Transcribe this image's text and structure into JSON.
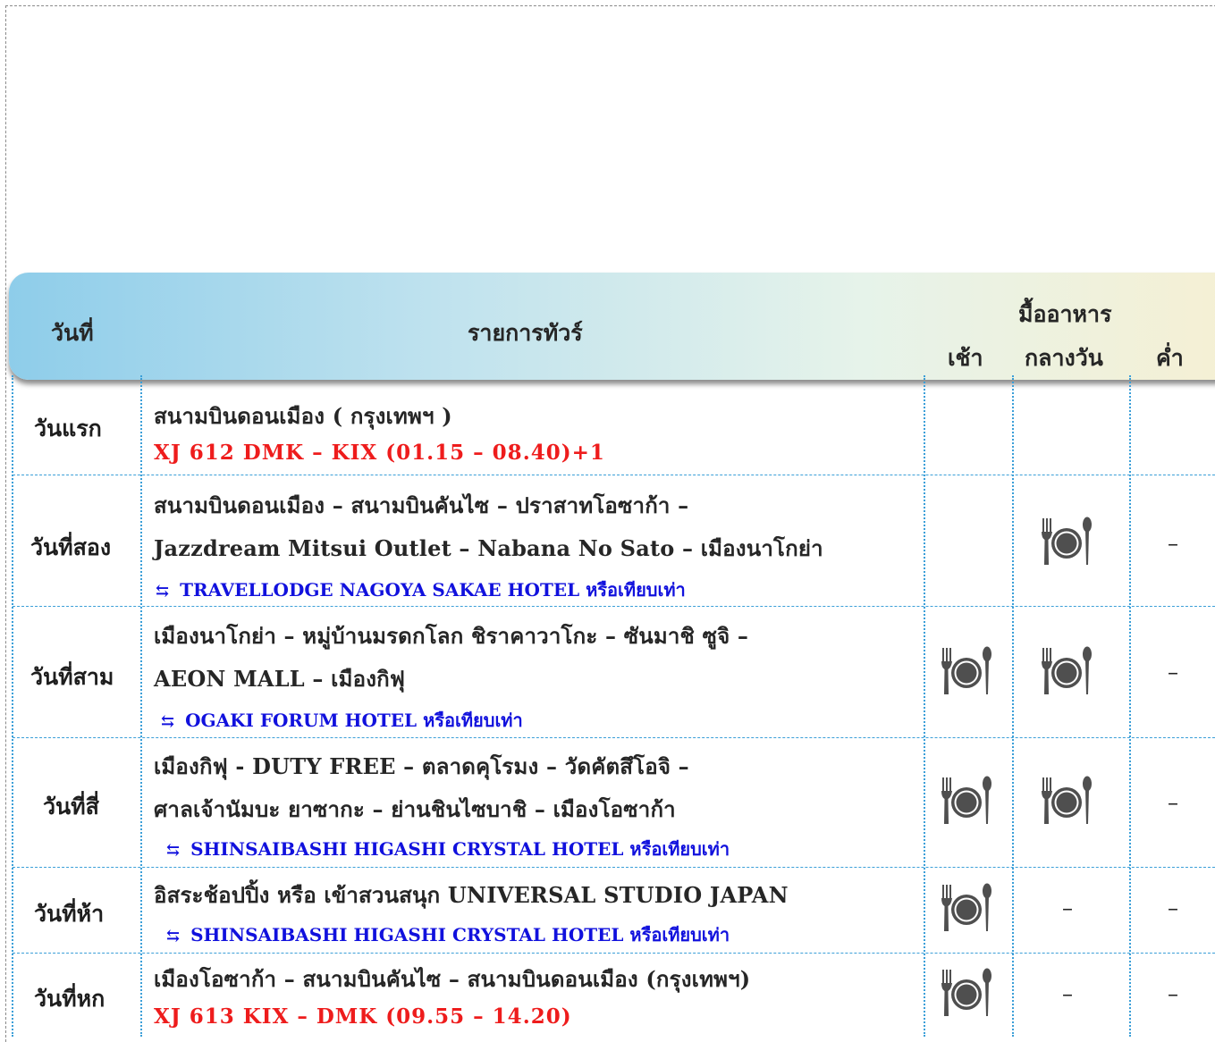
{
  "header": {
    "day_col": "วันที่",
    "program_col": "รายการทัวร์",
    "meals_group": "มื้ออาหาร",
    "breakfast": "เช้า",
    "lunch": "กลางวัน",
    "dinner": "ค่ำ"
  },
  "icons": {
    "meal": "plate-fork-knife-icon",
    "hotel": "bed-icon"
  },
  "colors": {
    "flight_text": "#ee1c1c",
    "hotel_text": "#1111dd",
    "grid_line": "#3b9fd8",
    "icon": "#4f4f4f"
  },
  "rows": [
    {
      "day": "วันแรก",
      "lines": [
        "สนามบินดอนเมือง ( กรุงเทพฯ )"
      ],
      "flight": "XJ 612  DMK – KIX  (01.15 – 08.40)+1",
      "hotel": "",
      "meals": {
        "breakfast": "",
        "lunch": "",
        "dinner": ""
      }
    },
    {
      "day": "วันที่สอง",
      "lines": [
        "สนามบินดอนเมือง – สนามบินคันไซ – ปราสาทโอซาก้า –",
        "Jazzdream Mitsui Outlet – Nabana No Sato – เมืองนาโกย่า"
      ],
      "flight": "",
      "hotel": "TRAVELLODGE NAGOYA SAKAE HOTEL หรือเทียบเท่า",
      "meals": {
        "breakfast": "",
        "lunch": "icon",
        "dinner": "–"
      }
    },
    {
      "day": "วันที่สาม",
      "lines": [
        "เมืองนาโกย่า – หมู่บ้านมรดกโลก ชิราคาวาโกะ – ซันมาชิ ซูจิ –",
        "AEON MALL – เมืองกิฟุ"
      ],
      "flight": "",
      "hotel": "OGAKI FORUM HOTEL หรือเทียบเท่า",
      "meals": {
        "breakfast": "icon",
        "lunch": "icon",
        "dinner": "–"
      }
    },
    {
      "day": "วันที่สี่",
      "lines": [
        "เมืองกิฟุ - DUTY FREE – ตลาดคุโรมง – วัดคัตสึโอจิ –",
        "ศาลเจ้านัมบะ ยาซากะ – ย่านชินไซบาชิ – เมืองโอซาก้า"
      ],
      "flight": "",
      "hotel": "SHINSAIBASHI HIGASHI CRYSTAL HOTEL หรือเทียบเท่า",
      "meals": {
        "breakfast": "icon",
        "lunch": "icon",
        "dinner": "–"
      }
    },
    {
      "day": "วันที่ห้า",
      "lines": [
        "อิสระช้อปปิ้ง หรือ เข้าสวนสนุก UNIVERSAL STUDIO JAPAN"
      ],
      "flight": "",
      "hotel": "SHINSAIBASHI HIGASHI CRYSTAL HOTEL หรือเทียบเท่า",
      "meals": {
        "breakfast": "icon",
        "lunch": "–",
        "dinner": "–"
      }
    },
    {
      "day": "วันที่หก",
      "lines": [
        "เมืองโอซาก้า – สนามบินคันไซ – สนามบินดอนเมือง (กรุงเทพฯ)"
      ],
      "flight": "XJ 613  KIX – DMK  (09.55 – 14.20)",
      "hotel": "",
      "meals": {
        "breakfast": "icon",
        "lunch": "–",
        "dinner": "–"
      }
    }
  ]
}
